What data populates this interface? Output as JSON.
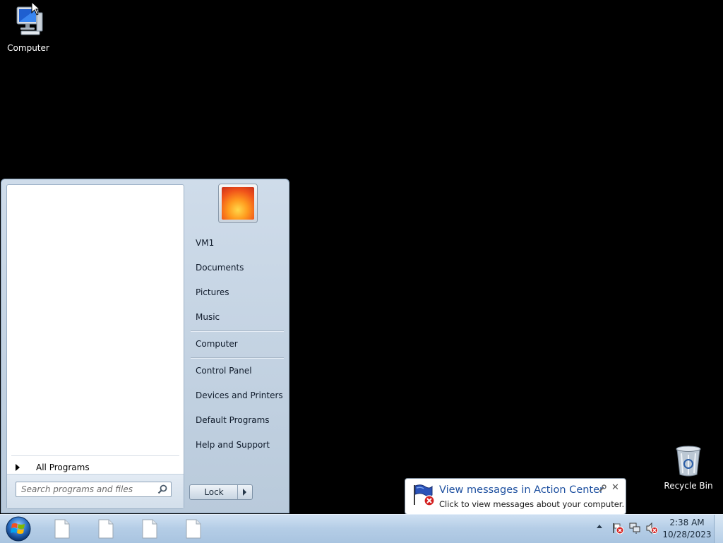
{
  "desktop": {
    "icons": [
      {
        "label": "Computer",
        "icon": "computer-icon"
      },
      {
        "label": "Recycle Bin",
        "icon": "recycle-bin-icon"
      }
    ]
  },
  "start_menu": {
    "all_programs_label": "All Programs",
    "search_placeholder": "Search programs and files",
    "user_picture": "flower-user-picture",
    "right_items": [
      {
        "label": "VM1"
      },
      {
        "label": "Documents"
      },
      {
        "label": "Pictures"
      },
      {
        "label": "Music"
      },
      {
        "label": "Computer"
      },
      {
        "label": "Control Panel"
      },
      {
        "label": "Devices and Printers"
      },
      {
        "label": "Default Programs"
      },
      {
        "label": "Help and Support"
      }
    ],
    "lock_label": "Lock"
  },
  "taskbar": {
    "start_button": "windows-orb-icon",
    "pinned": [
      "document-icon",
      "document-icon",
      "document-icon",
      "document-icon"
    ],
    "tray_icons": [
      "show-hidden-icons",
      "action-center-error-icon",
      "network-icon",
      "speaker-muted-icon"
    ],
    "clock_time": "2:38 AM",
    "clock_date": "10/28/2023"
  },
  "notification": {
    "title": "View messages in Action Center",
    "text": "Click to view messages about your computer.",
    "icon": "action-center-flag-icon"
  },
  "colors": {
    "desktop_bg": "#000000",
    "taskbar_bg": "#b4cde6",
    "balloon_title": "#1e50a0"
  }
}
